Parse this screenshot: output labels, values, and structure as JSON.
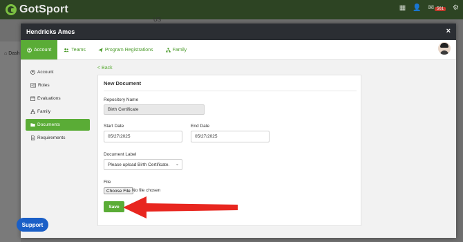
{
  "app": {
    "logo_text": "GotSport",
    "notification_count": "561"
  },
  "background": {
    "us_text": "US",
    "dash_text": "Dash"
  },
  "modal": {
    "title": "Hendricks Ames",
    "close_label": "×"
  },
  "tabs": [
    {
      "label": "Account",
      "icon": "user-circle-icon",
      "active": true
    },
    {
      "label": "Teams",
      "icon": "users-icon",
      "active": false
    },
    {
      "label": "Program Registrations",
      "icon": "paper-plane-icon",
      "active": false
    },
    {
      "label": "Family",
      "icon": "sitemap-icon",
      "active": false
    }
  ],
  "sidenav": [
    {
      "label": "Account",
      "icon": "user-circle-icon",
      "active": false
    },
    {
      "label": "Roles",
      "icon": "id-card-icon",
      "active": false
    },
    {
      "label": "Evaluations",
      "icon": "calendar-icon",
      "active": false
    },
    {
      "label": "Family",
      "icon": "sitemap-icon",
      "active": false
    },
    {
      "label": "Documents",
      "icon": "folder-icon",
      "active": true
    },
    {
      "label": "Requirements",
      "icon": "file-icon",
      "active": false
    }
  ],
  "back_link": "< Back",
  "form": {
    "title": "New Document",
    "repository_label": "Repository Name",
    "repository_value": "Birth Certificate",
    "start_label": "Start Date",
    "start_value": "05/27/2025",
    "end_label": "End Date",
    "end_value": "05/27/2025",
    "doc_label": "Document Label",
    "doc_value": "Please upload Birth Certificate.",
    "file_label": "File",
    "file_button": "Choose File",
    "file_status": "No file chosen",
    "save_label": "Save"
  },
  "support_label": "Support",
  "colors": {
    "accent": "#5aac36",
    "header": "#2b2e33",
    "arrow": "#e8261f",
    "support": "#1a5fc7"
  }
}
